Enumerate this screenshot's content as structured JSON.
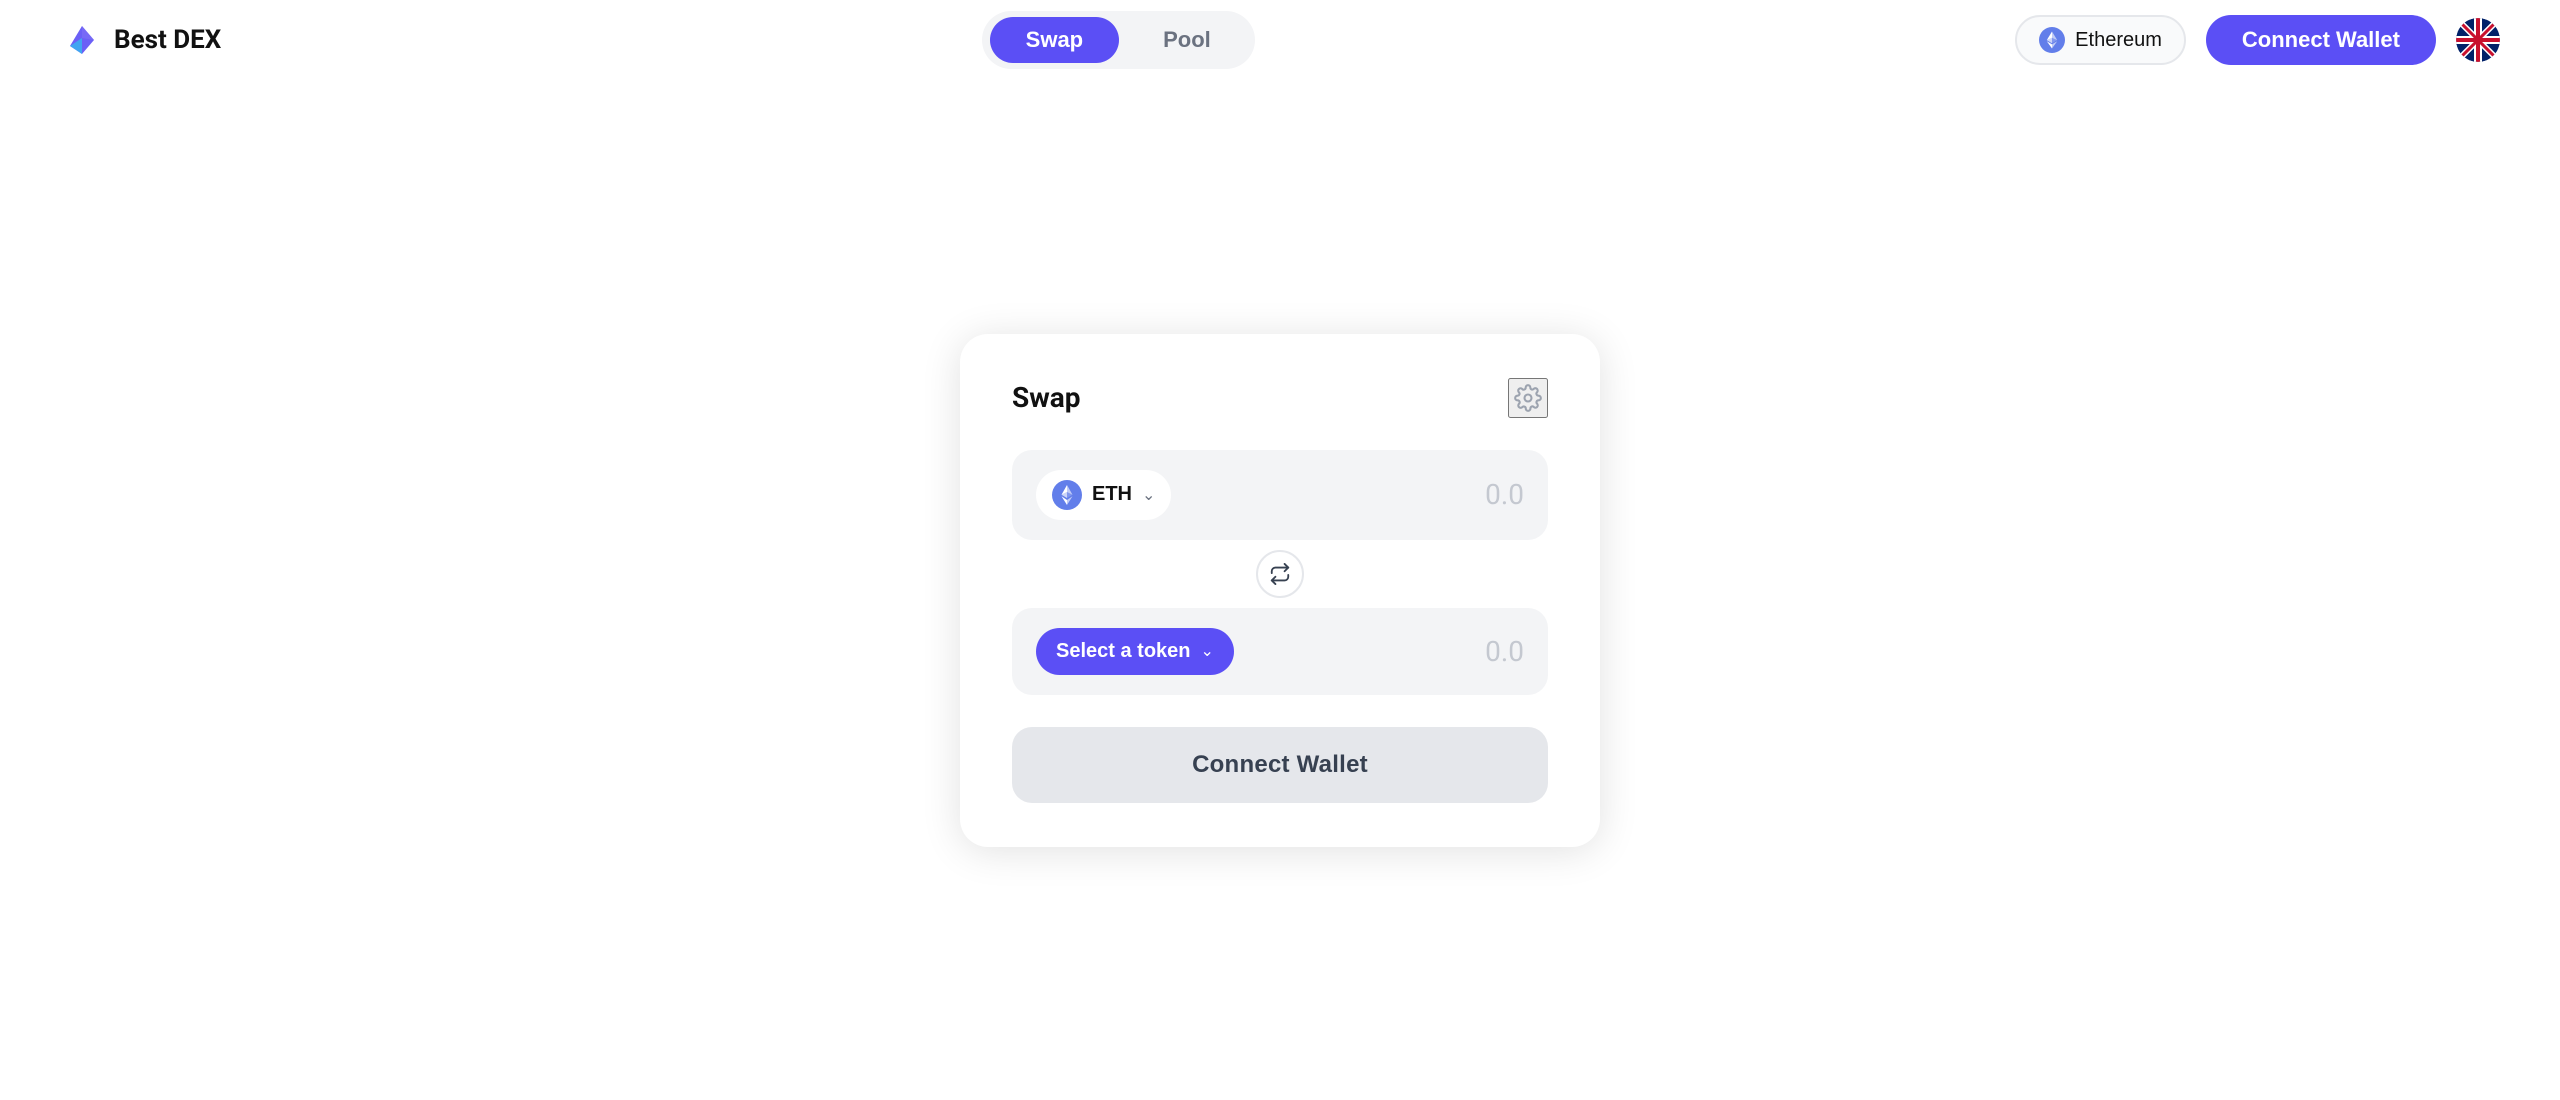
{
  "header": {
    "logo_text": "Best DEX",
    "nav": {
      "swap_label": "Swap",
      "pool_label": "Pool"
    },
    "network": {
      "label": "Ethereum"
    },
    "connect_wallet_label": "Connect Wallet"
  },
  "swap_card": {
    "title": "Swap",
    "from_token": {
      "symbol": "ETH",
      "amount": "0.0"
    },
    "to_token": {
      "placeholder": "Select a token",
      "amount": "0.0"
    },
    "connect_wallet_label": "Connect Wallet"
  },
  "icons": {
    "settings": "⚙",
    "swap_vertical": "⇅",
    "chevron_down": "∨"
  }
}
